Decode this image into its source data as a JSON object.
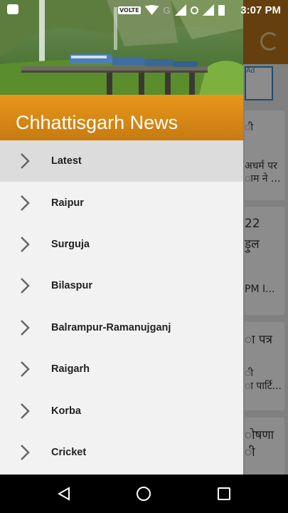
{
  "status_bar": {
    "time": "3:07 PM",
    "network_label": "VOLTE",
    "network_g": "G"
  },
  "background_app": {
    "ad_label": "Ad",
    "cards": [
      {
        "lines": [
          "ी",
          "अधर्म पर",
          "ाम ने ..."
        ]
      },
      {
        "lines": [
          "22",
          "ड़ुल",
          "PM I..."
        ]
      },
      {
        "lines": [
          "ा पत्र",
          "ी",
          "ा पार्टि..."
        ]
      },
      {
        "lines": [
          "ोषणा",
          "ी"
        ]
      }
    ]
  },
  "drawer": {
    "title": "Chhattisgarh News",
    "items": [
      {
        "label": "Latest",
        "active": true
      },
      {
        "label": "Raipur"
      },
      {
        "label": "Surguja"
      },
      {
        "label": "Bilaspur"
      },
      {
        "label": "Balrampur-Ramanujganj"
      },
      {
        "label": "Raigarh"
      },
      {
        "label": "Korba"
      },
      {
        "label": "Cricket"
      }
    ]
  },
  "colors": {
    "accent": "#e08e17",
    "toolbar": "#b8741a",
    "drawer_bg": "#f2f2f2",
    "active_row": "#dcdcdc"
  }
}
